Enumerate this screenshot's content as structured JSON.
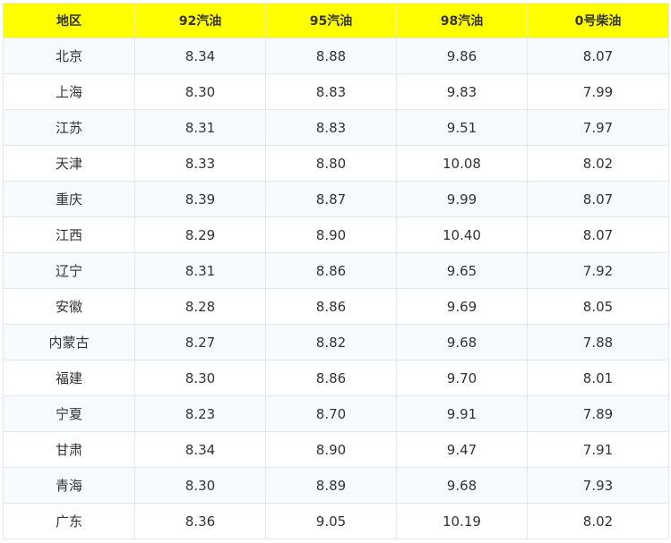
{
  "table": {
    "header_bg": "#ffff00",
    "headers": [
      "地区",
      "92汽油",
      "95汽油",
      "98汽油",
      "0号柴油"
    ],
    "rows": [
      [
        "北京",
        "8.34",
        "8.88",
        "9.86",
        "8.07"
      ],
      [
        "上海",
        "8.30",
        "8.83",
        "9.83",
        "7.99"
      ],
      [
        "江苏",
        "8.31",
        "8.83",
        "9.51",
        "7.97"
      ],
      [
        "天津",
        "8.33",
        "8.80",
        "10.08",
        "8.02"
      ],
      [
        "重庆",
        "8.39",
        "8.87",
        "9.99",
        "8.07"
      ],
      [
        "江西",
        "8.29",
        "8.90",
        "10.40",
        "8.07"
      ],
      [
        "辽宁",
        "8.31",
        "8.86",
        "9.65",
        "7.92"
      ],
      [
        "安徽",
        "8.28",
        "8.86",
        "9.69",
        "8.05"
      ],
      [
        "内蒙古",
        "8.27",
        "8.82",
        "9.68",
        "7.88"
      ],
      [
        "福建",
        "8.30",
        "8.86",
        "9.70",
        "8.01"
      ],
      [
        "宁夏",
        "8.23",
        "8.70",
        "9.91",
        "7.89"
      ],
      [
        "甘肃",
        "8.34",
        "8.90",
        "9.47",
        "7.91"
      ],
      [
        "青海",
        "8.30",
        "8.89",
        "9.68",
        "7.93"
      ],
      [
        "广东",
        "8.36",
        "9.05",
        "10.19",
        "8.02"
      ]
    ]
  }
}
